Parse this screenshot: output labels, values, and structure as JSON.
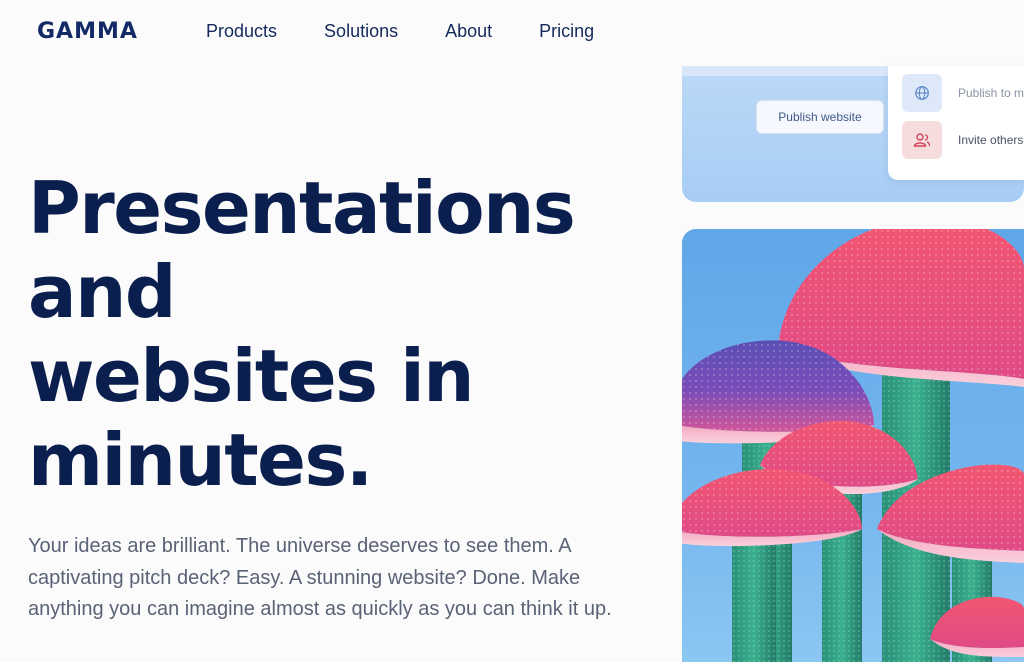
{
  "brand": {
    "logo_text": "GAMMA"
  },
  "nav": {
    "items": [
      {
        "label": "Products"
      },
      {
        "label": "Solutions"
      },
      {
        "label": "About"
      },
      {
        "label": "Pricing"
      }
    ]
  },
  "hero": {
    "headline_lines": [
      "Presentations",
      "and",
      "websites in",
      "minutes."
    ],
    "subtext": "Your ideas are brilliant. The universe deserves to see them. A captivating pitch deck? Easy. A stunning website? Done. Make anything you can imagine almost as quickly as you can think it up."
  },
  "preview_card": {
    "publish_button_label": "Publish website",
    "menu_items": [
      {
        "label": "Publish to m",
        "icon": "globe-icon"
      },
      {
        "label": "Invite others",
        "icon": "users-icon"
      }
    ]
  },
  "illustration": {
    "subject": "mushrooms-illustration"
  },
  "colors": {
    "brand_navy": "#0b1f4f",
    "body_text": "#5a6276",
    "sky": "#6fb2ec",
    "mushroom_pink": "#f0627a",
    "mushroom_stem": "#2f9e82"
  }
}
